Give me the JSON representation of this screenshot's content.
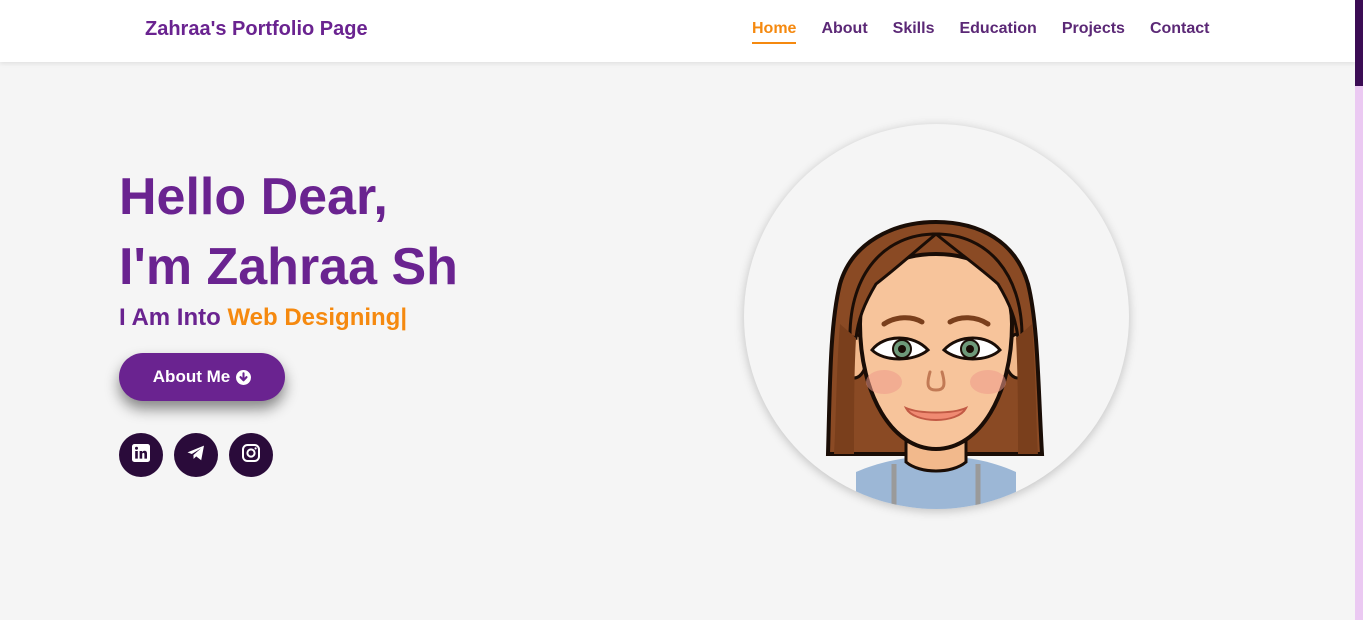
{
  "header": {
    "logo": "Zahraa's Portfolio Page",
    "nav": [
      {
        "label": "Home",
        "active": true
      },
      {
        "label": "About",
        "active": false
      },
      {
        "label": "Skills",
        "active": false
      },
      {
        "label": "Education",
        "active": false
      },
      {
        "label": "Projects",
        "active": false
      },
      {
        "label": "Contact",
        "active": false
      }
    ]
  },
  "hero": {
    "greeting": "Hello Dear,",
    "name_line": "I'm Zahraa Sh",
    "subtitle_prefix": "I Am Into ",
    "subtitle_typed": "Web Designing|",
    "button_label": "About Me",
    "button_icon": "arrow-down-circle-icon",
    "socials": [
      {
        "icon": "linkedin-icon"
      },
      {
        "icon": "telegram-icon"
      },
      {
        "icon": "instagram-icon"
      }
    ]
  },
  "colors": {
    "primary": "#6a2390",
    "accent": "#f5890f",
    "background": "#f5f5f5",
    "social_bg": "#2a0b3a"
  }
}
